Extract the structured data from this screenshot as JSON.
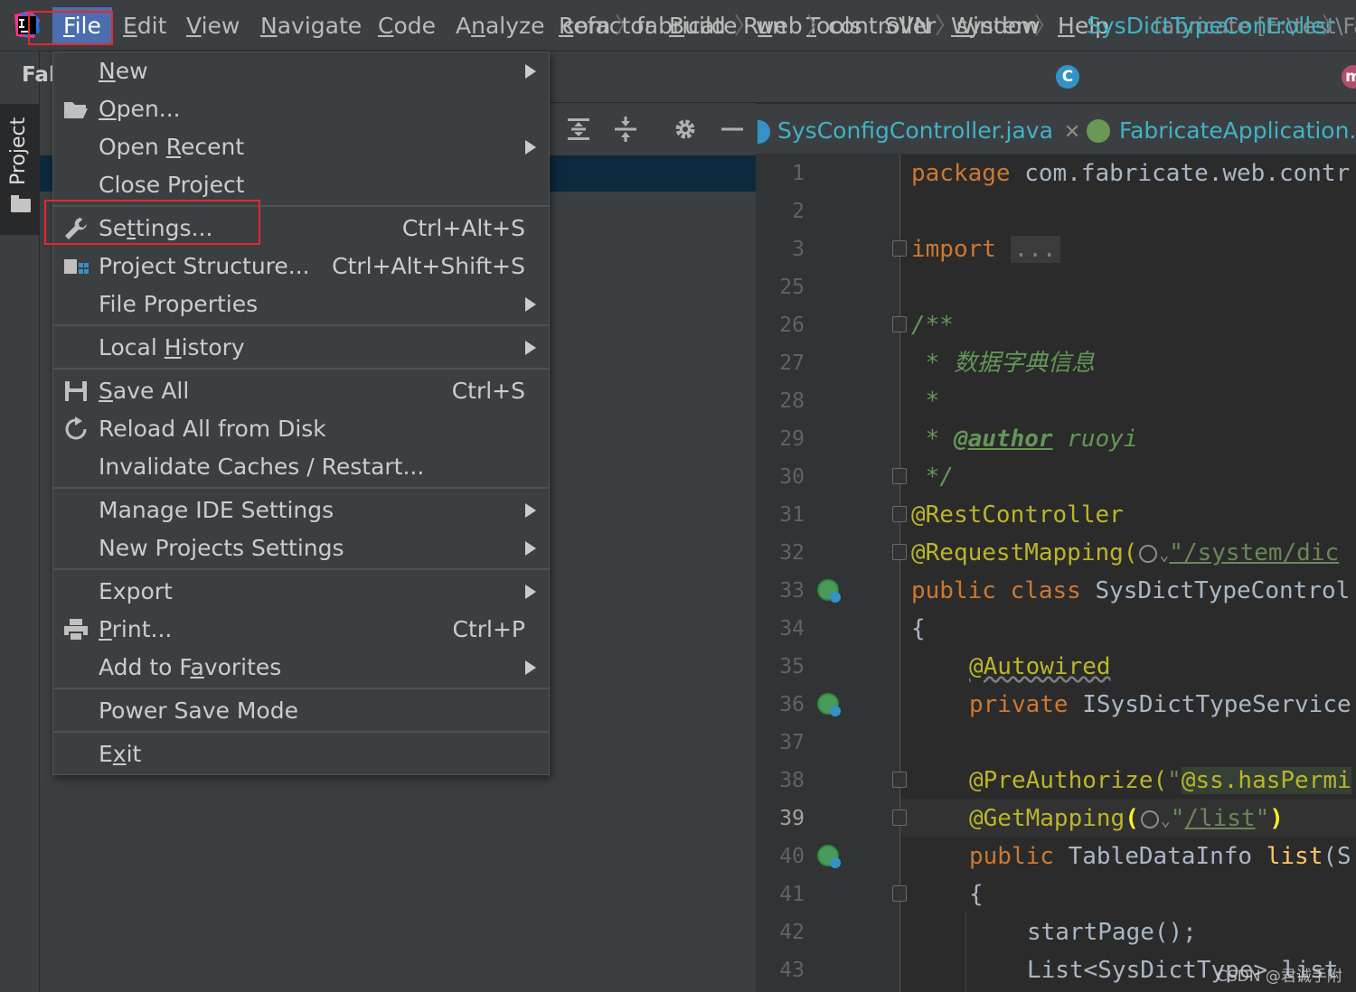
{
  "menubar": {
    "items": [
      {
        "label": "File",
        "mnemonic_index": 0
      },
      {
        "label": "Edit",
        "mnemonic_index": 0
      },
      {
        "label": "View",
        "mnemonic_index": 0
      },
      {
        "label": "Navigate",
        "mnemonic_index": 0
      },
      {
        "label": "Code",
        "mnemonic_index": 0
      },
      {
        "label": "Analyze",
        "mnemonic_index": 1
      },
      {
        "label": "Refactor",
        "mnemonic_index": 0
      },
      {
        "label": "Build",
        "mnemonic_index": 0
      },
      {
        "label": "Run",
        "mnemonic_index": 1
      },
      {
        "label": "Tools",
        "mnemonic_index": 0
      },
      {
        "label": "SVN",
        "mnemonic_index": -1
      },
      {
        "label": "Window",
        "mnemonic_index": 0
      },
      {
        "label": "Help",
        "mnemonic_index": 0
      }
    ],
    "active": "File",
    "window_title": "fabricate [E:\\test\\Fa"
  },
  "tool_strip": {
    "project_tab": "Project"
  },
  "project_panel": {
    "header_partial": "Fal"
  },
  "breadcrumb": {
    "items": [
      "com",
      "fabricate",
      "web",
      "controller",
      "system"
    ],
    "class_name": "SysDictTypeController",
    "class_icon_letter": "C",
    "trailing_icon_letter": "m"
  },
  "editor_tabs": [
    {
      "label": "SysConfigController.java",
      "closable": true
    },
    {
      "label": "FabricateApplication.jav",
      "closable": false
    }
  ],
  "file_menu": {
    "items": [
      {
        "label": "New",
        "mnemonic": "N",
        "shortcut": "",
        "submenu": true,
        "icon": ""
      },
      {
        "label": "Open...",
        "mnemonic": "O",
        "shortcut": "",
        "submenu": false,
        "icon": "folder-open-icon"
      },
      {
        "label": "Open Recent",
        "mnemonic": "R",
        "shortcut": "",
        "submenu": true,
        "icon": ""
      },
      {
        "label": "Close Project",
        "mnemonic": "j",
        "shortcut": "",
        "submenu": false,
        "icon": ""
      },
      {
        "label": "Settings...",
        "mnemonic": "t",
        "shortcut": "Ctrl+Alt+S",
        "submenu": false,
        "icon": "wrench-icon"
      },
      {
        "label": "Project Structure...",
        "mnemonic": "",
        "shortcut": "Ctrl+Alt+Shift+S",
        "submenu": false,
        "icon": "project-structure-icon"
      },
      {
        "label": "File Properties",
        "mnemonic": "",
        "shortcut": "",
        "submenu": true,
        "icon": ""
      },
      {
        "label": "Local History",
        "mnemonic": "H",
        "shortcut": "",
        "submenu": true,
        "icon": ""
      },
      {
        "label": "Save All",
        "mnemonic": "S",
        "shortcut": "Ctrl+S",
        "submenu": false,
        "icon": "save-icon"
      },
      {
        "label": "Reload All from Disk",
        "mnemonic": "",
        "shortcut": "",
        "submenu": false,
        "icon": "reload-icon"
      },
      {
        "label": "Invalidate Caches / Restart...",
        "mnemonic": "",
        "shortcut": "",
        "submenu": false,
        "icon": ""
      },
      {
        "label": "Manage IDE Settings",
        "mnemonic": "",
        "shortcut": "",
        "submenu": true,
        "icon": ""
      },
      {
        "label": "New Projects Settings",
        "mnemonic": "",
        "shortcut": "",
        "submenu": true,
        "icon": ""
      },
      {
        "label": "Export",
        "mnemonic": "",
        "shortcut": "",
        "submenu": true,
        "icon": ""
      },
      {
        "label": "Print...",
        "mnemonic": "P",
        "shortcut": "Ctrl+P",
        "submenu": false,
        "icon": "print-icon"
      },
      {
        "label": "Add to Favorites",
        "mnemonic": "a",
        "shortcut": "",
        "submenu": true,
        "icon": ""
      },
      {
        "label": "Power Save Mode",
        "mnemonic": "",
        "shortcut": "",
        "submenu": false,
        "icon": ""
      },
      {
        "label": "Exit",
        "mnemonic": "x",
        "shortcut": "",
        "submenu": false,
        "icon": ""
      }
    ],
    "highlighted": "Settings..."
  },
  "editor": {
    "line_numbers": [
      "1",
      "2",
      "3",
      "25",
      "26",
      "27",
      "28",
      "29",
      "30",
      "31",
      "32",
      "33",
      "34",
      "35",
      "36",
      "37",
      "38",
      "39",
      "40",
      "41",
      "42",
      "43"
    ],
    "current_line": "39",
    "code": {
      "l1_kw": "package",
      "l1_rest": " com.fabricate.web.contr",
      "l3_kw": "import",
      "l3_fold": "...",
      "l26": "/**",
      "l27": " * 数据字典信息",
      "l28": " *",
      "l29_star": " * ",
      "l29_tag": "@author",
      "l29_rest": " ruoyi",
      "l30": " */",
      "l31": "@RestController",
      "l32_ann": "@RequestMapping(",
      "l32_str": "\"/system/dic",
      "l33_kw": "public class",
      "l33_rest": " SysDictTypeControl",
      "l34": "{",
      "l35": "@Autowired",
      "l36_kw": "private",
      "l36_rest": " ISysDictTypeService",
      "l38_ann": "@PreAuthorize(",
      "l38_str": "\"",
      "l38_rest": "@ss.hasPermi",
      "l39_ann": "@GetMapping",
      "l39_open": "(",
      "l39_q": "\"",
      "l39_str": "/list",
      "l39_q2": "\"",
      "l39_close": ")",
      "l40_kw": "public",
      "l40_type": " TableDataInfo ",
      "l40_fn": "list",
      "l40_rest": "(S",
      "l41": "{",
      "l42": "startPage();",
      "l43": "List<SysDictType> list"
    }
  },
  "watermark": "CSDN @君诚手附"
}
